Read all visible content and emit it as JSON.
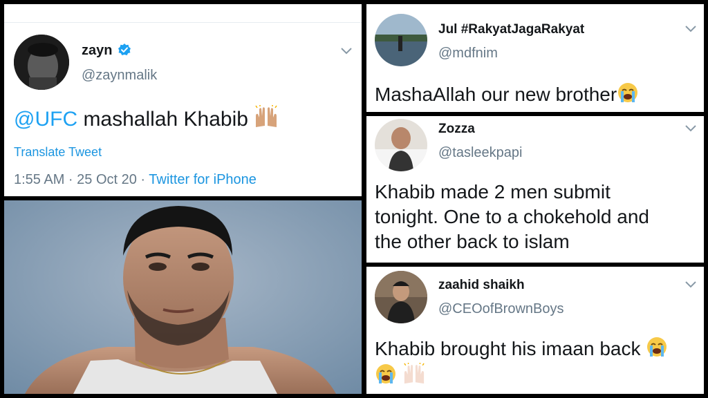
{
  "left_tweet": {
    "name": "zayn",
    "handle": "@zaynmalik",
    "mention": "@UFC",
    "text": " mashallah Khabib ",
    "translate": "Translate Tweet",
    "time_date": "1:55 AM · 25 Oct 20 · ",
    "source": "Twitter for iPhone",
    "verified_icon": "verified-badge-icon",
    "colors": {
      "link": "#1da1f2",
      "verified": "#1da1f2",
      "muted": "#657786"
    }
  },
  "reply1": {
    "name": "Jul #RakyatJagaRakyat",
    "handle": "@mdfnim",
    "text": "MashaAllah our new brother"
  },
  "reply2": {
    "name": "Zozza",
    "handle": "@tasleekpapi",
    "line1": "Khabib made 2 men submit",
    "line2": "tonight. One to a chokehold and",
    "line3": "the other back to islam"
  },
  "reply3": {
    "name": "zaahid shaikh",
    "handle": "@CEOofBrownBoys",
    "text": "Khabib brought his imaan back "
  }
}
